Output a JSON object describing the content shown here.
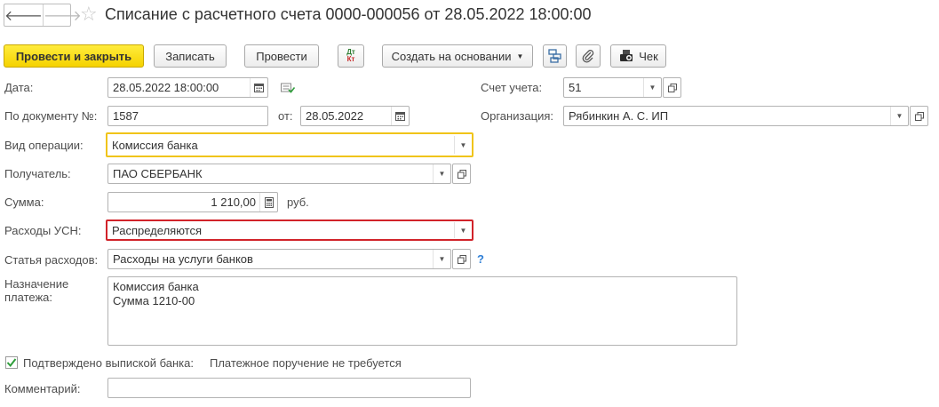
{
  "window": {
    "title": "Списание с расчетного счета 0000-000056 от 28.05.2022 18:00:00",
    "back_glyph": "🡐",
    "forward_glyph": "🡒"
  },
  "toolbar": {
    "post_close": "Провести и закрыть",
    "save": "Записать",
    "post": "Провести",
    "dtkt_dt": "Дт",
    "dtkt_kt": "Кт",
    "create_based": "Создать на основании",
    "check": "Чек"
  },
  "form": {
    "date_label": "Дата:",
    "date_value": "28.05.2022 18:00:00",
    "account_label": "Счет учета:",
    "account_value": "51",
    "doc_num_label": "По документу №:",
    "doc_num_value": "1587",
    "from_label": "от:",
    "from_value": "28.05.2022",
    "org_label": "Организация:",
    "org_value": "Рябинкин А. С. ИП",
    "operation_label": "Вид операции:",
    "operation_value": "Комиссия банка",
    "recipient_label": "Получатель:",
    "recipient_value": "ПАО СБЕРБАНК",
    "amount_label": "Сумма:",
    "amount_value": "1 210,00",
    "currency": "руб.",
    "usn_label": "Расходы УСН:",
    "usn_value": "Распределяются",
    "expense_label": "Статья расходов:",
    "expense_value": "Расходы на услуги банков",
    "help_mark": "?",
    "purpose_label_1": "Назначение",
    "purpose_label_2": "платежа:",
    "purpose_value": "Комиссия банка\nСумма 1210-00",
    "confirmed_label": "Подтверждено выпиской банка:",
    "confirmed_checked": true,
    "payment_order_text": "Платежное поручение не требуется",
    "comment_label": "Комментарий:",
    "comment_value": ""
  },
  "colors": {
    "primary_button": "#f5d200",
    "operation_highlight": "#f0c419",
    "usn_highlight": "#d1232a",
    "help_link": "#2f7fd6",
    "check_mark": "#2e9d3a"
  }
}
